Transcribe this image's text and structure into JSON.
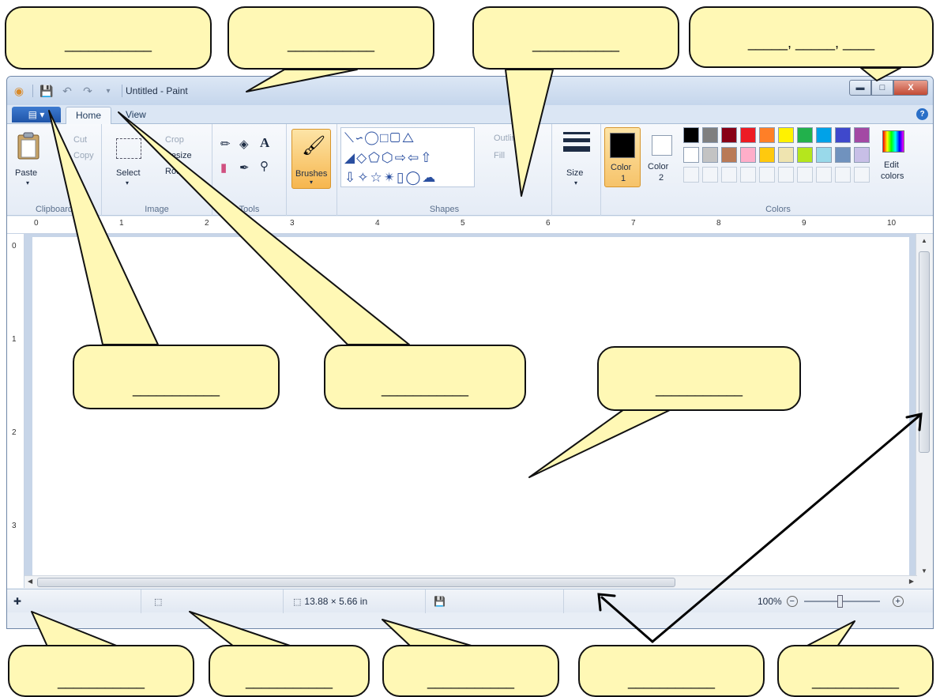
{
  "window": {
    "title": "Untitled - Paint",
    "qat_items": [
      "paint-icon",
      "save-icon",
      "undo-icon",
      "redo-icon",
      "customize-icon"
    ]
  },
  "tabs": {
    "home": "Home",
    "view": "View"
  },
  "ribbon": {
    "clipboard": {
      "paste": "Paste",
      "cut": "Cut",
      "copy": "Copy",
      "label": "Clipboard"
    },
    "image": {
      "select": "Select",
      "crop": "Crop",
      "resize": "Resize",
      "rotate": "Rotate",
      "label": "Image"
    },
    "tools": {
      "label": "Tools"
    },
    "brushes": {
      "label": "Brushes"
    },
    "shapes": {
      "outline": "Outline",
      "fill": "Fill",
      "label": "Shapes"
    },
    "size": {
      "label": "Size"
    },
    "color1": {
      "label": "Color",
      "num": "1"
    },
    "color2": {
      "label": "Color",
      "num": "2"
    },
    "colors": {
      "label": "Colors",
      "edit": "Edit",
      "edit2": "colors"
    }
  },
  "palette_row1": [
    "#000000",
    "#7f7f7f",
    "#880015",
    "#ed1c24",
    "#ff7f27",
    "#fff200",
    "#22b14c",
    "#00a2e8",
    "#3f48cc",
    "#a349a4"
  ],
  "palette_row2": [
    "#ffffff",
    "#c3c3c3",
    "#b97a57",
    "#ffaec9",
    "#ffc90e",
    "#efe4b0",
    "#b5e61d",
    "#99d9ea",
    "#7092be",
    "#c8bfe7"
  ],
  "colors_theme": {
    "color1_value": "#000000",
    "color2_value": "#ffffff",
    "accent": "#f9c264"
  },
  "ruler": {
    "top_ticks": [
      "0",
      "1",
      "2",
      "3",
      "4",
      "5",
      "6",
      "7",
      "8",
      "9",
      "10"
    ],
    "left_ticks": [
      "0",
      "1",
      "2",
      "3"
    ]
  },
  "status": {
    "canvas_size": "13.88 × 5.66 in",
    "zoom": "100%"
  },
  "callouts": {
    "blank": "___________",
    "blank_triple": "_____, _____, ____"
  }
}
